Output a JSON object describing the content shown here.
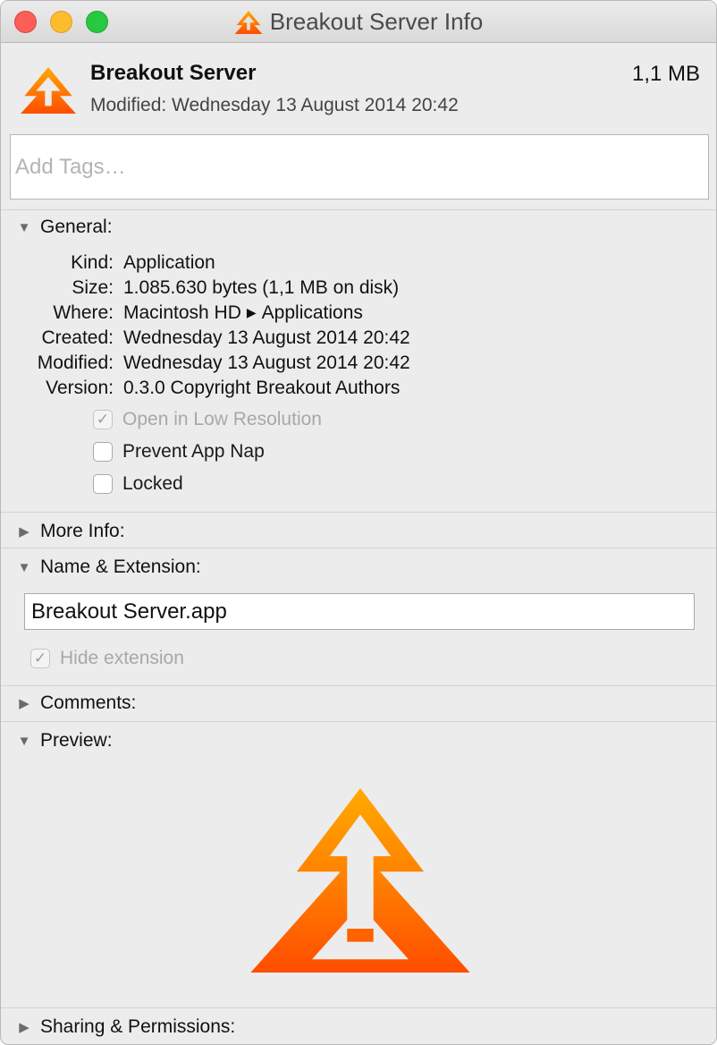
{
  "window": {
    "title": "Breakout Server Info"
  },
  "header": {
    "app_name": "Breakout Server",
    "size": "1,1 MB",
    "modified": "Modified: Wednesday 13 August 2014 20:42",
    "tags_placeholder": "Add Tags…"
  },
  "general": {
    "label": "General:",
    "rows": [
      {
        "label": "Kind:",
        "value": "Application"
      },
      {
        "label": "Size:",
        "value": "1.085.630 bytes (1,1 MB on disk)"
      },
      {
        "label": "Where:",
        "value_part1": "Macintosh HD",
        "value_part2": "Applications"
      },
      {
        "label": "Created:",
        "value": "Wednesday 13 August 2014 20:42"
      },
      {
        "label": "Modified:",
        "value": "Wednesday 13 August 2014 20:42"
      },
      {
        "label": "Version:",
        "value": "0.3.0 Copyright Breakout Authors"
      }
    ],
    "checkboxes": [
      {
        "label": "Open in Low Resolution",
        "checked": true,
        "disabled": true
      },
      {
        "label": "Prevent App Nap",
        "checked": false,
        "disabled": false
      },
      {
        "label": "Locked",
        "checked": false,
        "disabled": false
      }
    ]
  },
  "more_info": {
    "label": "More Info:"
  },
  "name_extension": {
    "label": "Name & Extension:",
    "filename": "Breakout Server.app",
    "hide_extension_label": "Hide extension",
    "hide_extension_checked": true
  },
  "comments": {
    "label": "Comments:"
  },
  "preview": {
    "label": "Preview:"
  },
  "sharing": {
    "label": "Sharing & Permissions:"
  },
  "icons": {
    "disclosure_open": "triangle-down-icon",
    "disclosure_closed": "triangle-right-icon",
    "app": "breakout-arrow-icon",
    "check": "checkmark-icon"
  },
  "colors": {
    "accent_orange": "#ff5a00",
    "accent_yellow": "#ffa500"
  }
}
